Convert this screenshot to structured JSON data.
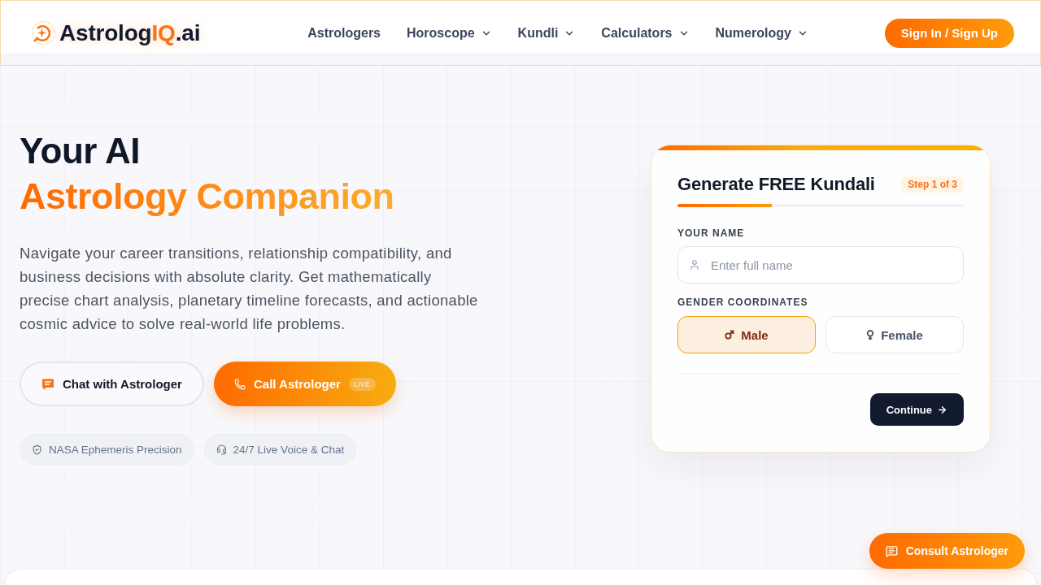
{
  "header": {
    "logo": {
      "text_before": "Astrolog",
      "highlight": "IQ",
      "text_after": ".ai"
    },
    "nav": [
      {
        "label": "Astrologers",
        "has_menu": false
      },
      {
        "label": "Horoscope",
        "has_menu": true
      },
      {
        "label": "Kundli",
        "has_menu": true
      },
      {
        "label": "Calculators",
        "has_menu": true
      },
      {
        "label": "Numerology",
        "has_menu": true
      }
    ],
    "sign_in": "Sign In / Sign Up"
  },
  "hero": {
    "title": "Your AI",
    "title_accent": "Astrology Companion",
    "description": "Navigate your career transitions, relationship compatibility, and business decisions with absolute clarity. Get mathematically precise chart analysis, planetary timeline forecasts, and actionable cosmic advice to solve real-world life problems.",
    "actions": [
      {
        "label": "Chat with Astrologer",
        "kind": "outline"
      },
      {
        "label": "Call Astrologer",
        "kind": "primary",
        "badge": "LIVE"
      }
    ],
    "features": [
      "NASA Ephemeris Precision",
      "24/7 Live Voice & Chat"
    ]
  },
  "kundali_form": {
    "title": "Generate FREE Kundali",
    "step": "Step 1 of 3",
    "progress": {
      "level": 0.33
    },
    "name_field": {
      "label": "YOUR NAME",
      "placeholder": "Enter full name"
    },
    "gender": {
      "label": "GENDER COORDINATES",
      "options": [
        {
          "label": "Male",
          "selected": true
        },
        {
          "label": "Female",
          "selected": false
        }
      ]
    },
    "continue": "Continue"
  },
  "floating_button": {
    "label": "Consult Astrologer"
  }
}
